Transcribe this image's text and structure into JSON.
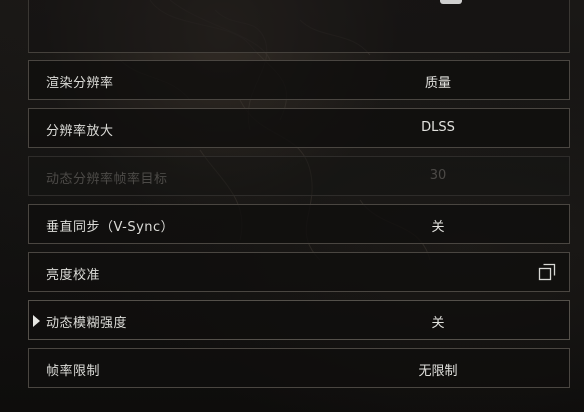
{
  "settings": {
    "rows": [
      {
        "label": "渲染分辨率",
        "value": "质量",
        "enabled": true
      },
      {
        "label": "分辨率放大",
        "value": "DLSS",
        "enabled": true
      },
      {
        "label": "动态分辨率帧率目标",
        "value": "30",
        "enabled": false
      },
      {
        "label": "垂直同步（V-Sync）",
        "value": "关",
        "enabled": true
      },
      {
        "label": "亮度校准",
        "value": "",
        "enabled": true,
        "icon": "open-external-icon"
      },
      {
        "label": "动态模糊强度",
        "value": "关",
        "enabled": true,
        "selected": true
      },
      {
        "label": "帧率限制",
        "value": "无限制",
        "enabled": true
      }
    ]
  },
  "colors": {
    "text": "#dcdcd8",
    "disabled_text": "#4c4a47",
    "row_border": "#4a4641",
    "background": "#141312"
  }
}
